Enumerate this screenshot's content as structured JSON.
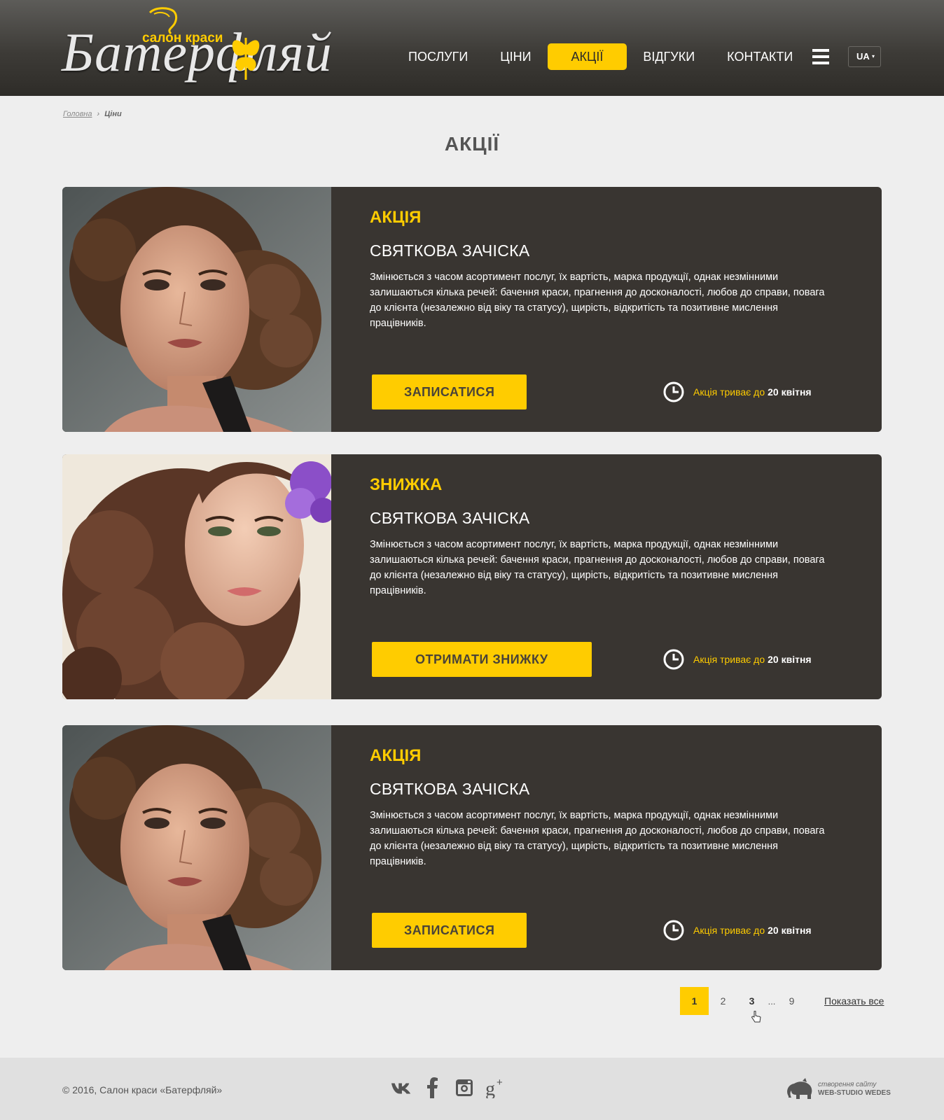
{
  "brand": {
    "subtitle": "салон краси",
    "name": "Батерфляй"
  },
  "nav": {
    "items": [
      {
        "label": "ПОСЛУГИ"
      },
      {
        "label": "ЦІНИ"
      },
      {
        "label": "АКЦІЇ"
      },
      {
        "label": "ВІДГУКИ"
      },
      {
        "label": "КОНТАКТИ"
      }
    ],
    "active": "АКЦІЇ"
  },
  "language": {
    "selected": "UA",
    "caret": "▾"
  },
  "breadcrumb": {
    "home": "Головна",
    "separator": "›",
    "current": "Ціни"
  },
  "page": {
    "title": "АКЦІЇ"
  },
  "promos": [
    {
      "type": "АКЦІЯ",
      "title": "СВЯТКОВА ЗАЧІСКА",
      "description": "Змінюється з часом асортимент послуг, їх вартість, марка продукції, однак незмінними залишаються кілька речей: бачення краси, прагнення до досконалості, любов до справи, повага до клієнта (незалежно від віку та статусу), щирість, відкритість та позитивне мислення працівників.",
      "button": "ЗАПИСАТИСЯ",
      "until_label": "Акція триває до",
      "until_date": "20 квітня",
      "image": "woman-portrait-curls"
    },
    {
      "type": "ЗНИЖКА",
      "title": "СВЯТКОВА ЗАЧІСКА",
      "description": "Змінюється з часом асортимент послуг, їх вартість, марка продукції, однак незмінними залишаються кілька речей: бачення краси, прагнення до досконалості, любов до справи, повага до клієнта (незалежно від віку та статусу), щирість, відкритість та позитивне мислення працівників.",
      "button": "ОТРИМАТИ ЗНИЖКУ",
      "until_label": "Акція триває до",
      "until_date": "20 квітня",
      "image": "woman-portrait-flower"
    },
    {
      "type": "АКЦІЯ",
      "title": "СВЯТКОВА ЗАЧІСКА",
      "description": "Змінюється з часом асортимент послуг, їх вартість, марка продукції, однак незмінними залишаються кілька речей: бачення краси, прагнення до досконалості, любов до справи, повага до клієнта (незалежно від віку та статусу), щирість, відкритість та позитивне мислення працівників.",
      "button": "ЗАПИСАТИСЯ",
      "until_label": "Акція триває до",
      "until_date": "20 квітня",
      "image": "woman-portrait-curls"
    }
  ],
  "pagination": {
    "pages": [
      "1",
      "2",
      "3",
      "9"
    ],
    "current": "1",
    "ellipsis": "...",
    "show_all": "Показать все"
  },
  "footer": {
    "copyright": "© 2016, Салон краси «Батерфляй»",
    "socials": [
      "vk-icon",
      "facebook-icon",
      "instagram-icon",
      "google-plus-icon"
    ],
    "studio_top": "створення сайту",
    "studio_name": "WEB-STUDIO WEDES"
  },
  "colors": {
    "accent": "#ffcc00",
    "card_bg": "#393531",
    "header_bg": "#3d3b37",
    "page_bg": "#eeeeee",
    "footer_bg": "#e0e0e0"
  }
}
